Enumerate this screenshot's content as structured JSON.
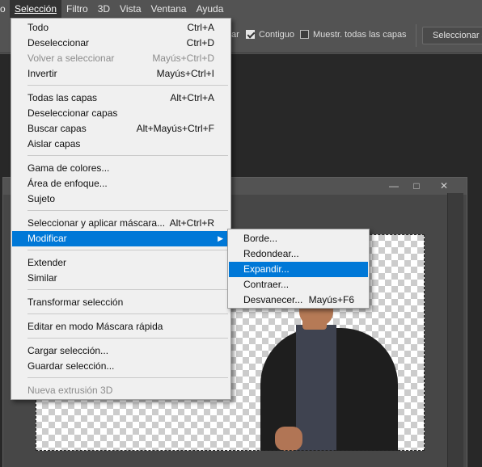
{
  "menubar": {
    "items": [
      "o",
      "Selección",
      "Filtro",
      "3D",
      "Vista",
      "Ventana",
      "Ayuda"
    ]
  },
  "options": {
    "partial_label": "ar",
    "contiguous_label": "Contiguo",
    "contiguous_checked": true,
    "sample_all_label": "Muestr. todas las capas",
    "sample_all_checked": false,
    "select_subject_label": "Seleccionar su"
  },
  "seleccion_menu": {
    "items": [
      {
        "label": "Todo",
        "shortcut": "Ctrl+A"
      },
      {
        "label": "Deseleccionar",
        "shortcut": "Ctrl+D"
      },
      {
        "label": "Volver a seleccionar",
        "shortcut": "Mayús+Ctrl+D",
        "disabled": true
      },
      {
        "label": "Invertir",
        "shortcut": "Mayús+Ctrl+I"
      },
      {
        "label": "Todas las capas",
        "shortcut": "Alt+Ctrl+A"
      },
      {
        "label": "Deseleccionar capas",
        "shortcut": ""
      },
      {
        "label": "Buscar capas",
        "shortcut": "Alt+Mayús+Ctrl+F"
      },
      {
        "label": "Aislar capas",
        "shortcut": ""
      },
      {
        "label": "Gama de colores...",
        "shortcut": ""
      },
      {
        "label": "Área de enfoque...",
        "shortcut": ""
      },
      {
        "label": "Sujeto",
        "shortcut": ""
      },
      {
        "label": "Seleccionar y aplicar máscara...",
        "shortcut": "Alt+Ctrl+R"
      },
      {
        "label": "Modificar",
        "shortcut": "",
        "submenu": true,
        "highlighted": true
      },
      {
        "label": "Extender",
        "shortcut": ""
      },
      {
        "label": "Similar",
        "shortcut": ""
      },
      {
        "label": "Transformar selección",
        "shortcut": ""
      },
      {
        "label": "Editar en modo Máscara rápida",
        "shortcut": ""
      },
      {
        "label": "Cargar selección...",
        "shortcut": ""
      },
      {
        "label": "Guardar selección...",
        "shortcut": ""
      },
      {
        "label": "Nueva extrusión 3D",
        "shortcut": "",
        "disabled": true
      }
    ]
  },
  "modificar_submenu": {
    "items": [
      {
        "label": "Borde...",
        "shortcut": ""
      },
      {
        "label": "Redondear...",
        "shortcut": ""
      },
      {
        "label": "Expandir...",
        "shortcut": "",
        "highlighted": true
      },
      {
        "label": "Contraer...",
        "shortcut": ""
      },
      {
        "label": "Desvanecer...",
        "shortcut": "Mayús+F6"
      }
    ]
  },
  "document_window": {
    "buttons": [
      "minimize-icon",
      "maximize-icon",
      "close-icon"
    ]
  },
  "colors": {
    "menu_highlight": "#0078d7",
    "menu_background": "#f0f0f0",
    "workspace": "#282828",
    "chrome": "#535353"
  }
}
